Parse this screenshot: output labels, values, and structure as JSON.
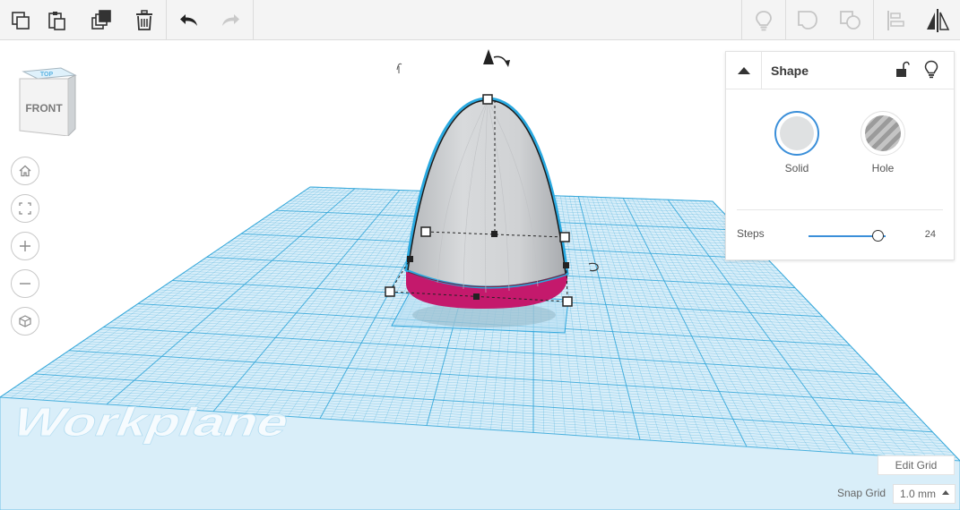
{
  "toolbar": {
    "left_icons": [
      "copy-icon",
      "paste-icon",
      "duplicate-icon",
      "trash-icon",
      "undo-icon",
      "redo-icon"
    ],
    "right_icons": [
      "note-bulb-icon",
      "group-icon",
      "ungroup-icon",
      "align-icon",
      "mirror-icon"
    ]
  },
  "viewcube": {
    "top_face": "TOP",
    "front_face": "FRONT"
  },
  "nav_buttons": [
    "home-icon",
    "fit-view-icon",
    "zoom-in-icon",
    "zoom-out-icon",
    "perspective-icon"
  ],
  "workplane": {
    "watermark": "Workplane",
    "grid_color": "#2fa4d8"
  },
  "shape": {
    "surface_color": "#d2d4d6",
    "outline_color": "#29a9e0",
    "base_color": "#c4196c"
  },
  "panel": {
    "title": "Shape",
    "solid_label": "Solid",
    "hole_label": "Hole",
    "steps_label": "Steps",
    "steps_value": "24",
    "steps_fraction": 0.89
  },
  "footer": {
    "edit_grid": "Edit Grid",
    "snap_grid_label": "Snap Grid",
    "snap_grid_value": "1.0 mm"
  }
}
